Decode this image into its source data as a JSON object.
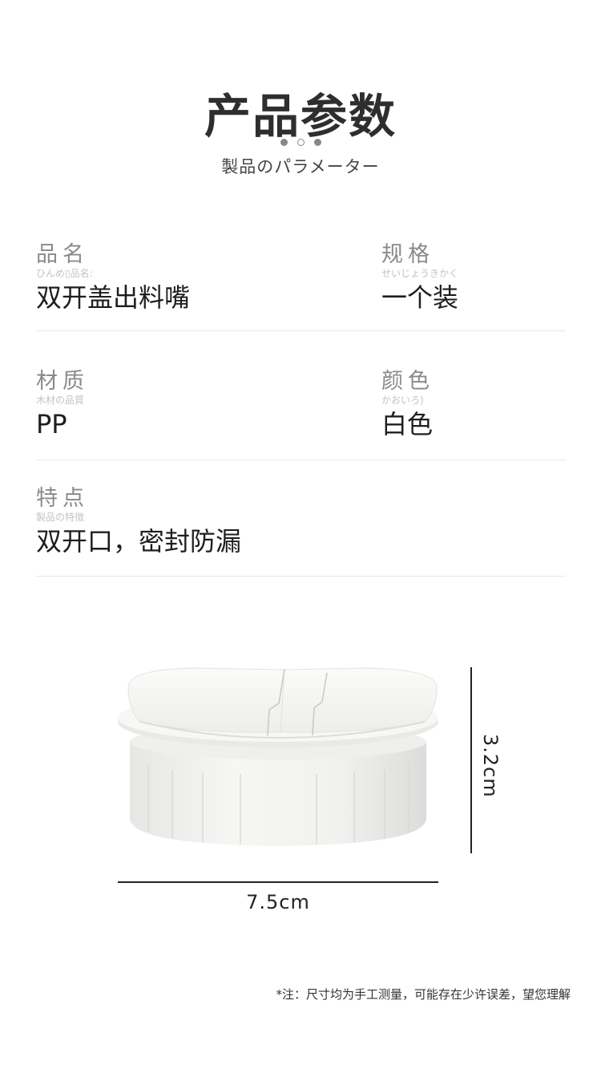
{
  "header": {
    "title": "产品参数",
    "subtitle": "製品のパラメーター"
  },
  "params": {
    "name": {
      "label": "品名",
      "kana": "ひんめ▯品名:",
      "value": "双开盖出料嘴"
    },
    "spec": {
      "label": "规格",
      "kana": "せいじょうきかく",
      "value": "一个装"
    },
    "material": {
      "label": "材质",
      "kana": "木材の品質",
      "value": "PP"
    },
    "color": {
      "label": "颜色",
      "kana": "かおいろ)",
      "value": "白色"
    },
    "feature": {
      "label": "特点",
      "kana": "製品の特徴",
      "value": "双开口，密封防漏"
    }
  },
  "dimensions": {
    "height": "3.2cm",
    "width": "7.5cm"
  },
  "note": "*注：尺寸均为手工测量，可能存在少许误差，望您理解",
  "colors": {
    "background": "#ffffff",
    "title": "#2e2e2e",
    "label": "#8a8a8a",
    "kana": "#c4c4c4",
    "value": "#1e1e1e",
    "divider": "#e8e8e8"
  }
}
